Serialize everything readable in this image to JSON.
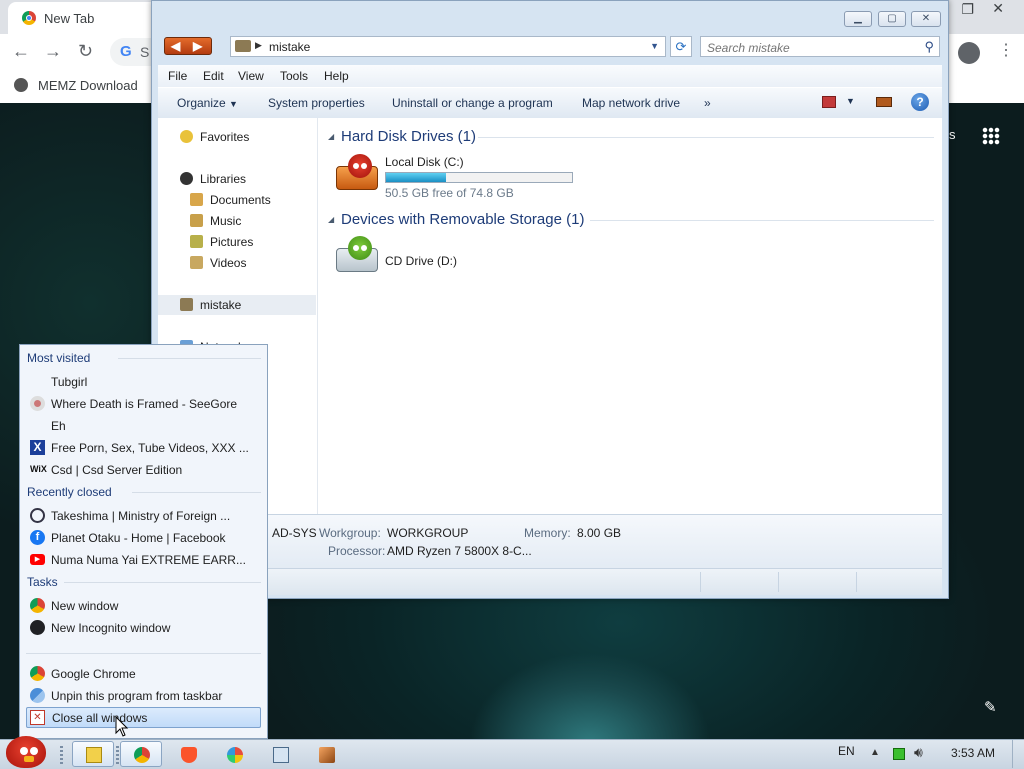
{
  "chrome": {
    "tab_title": "New Tab",
    "omnibox_partial": "S",
    "bookmark": "MEMZ Download",
    "right_partial": "s"
  },
  "explorer": {
    "address": "mistake",
    "search_placeholder": "Search mistake",
    "menu": [
      "File",
      "Edit",
      "View",
      "Tools",
      "Help"
    ],
    "commands": {
      "organize": "Organize",
      "system_properties": "System properties",
      "uninstall": "Uninstall or change a program",
      "map_drive": "Map network drive",
      "more": "»"
    },
    "nav": {
      "favorites": "Favorites",
      "libraries": "Libraries",
      "documents": "Documents",
      "music": "Music",
      "pictures": "Pictures",
      "videos": "Videos",
      "computer": "mistake",
      "network_partial": "Network",
      "homegroup_partial": "g"
    },
    "groups": {
      "hdd": "Hard Disk Drives (1)",
      "removable": "Devices with Removable Storage (1)"
    },
    "drives": {
      "c_name": "Local Disk (C:)",
      "c_free": "50.5 GB free of 74.8 GB",
      "c_used_fraction": 0.325,
      "d_name": "CD Drive (D:)"
    },
    "details": {
      "computer_partial": "AD-SYS",
      "workgroup_label": "Workgroup:",
      "workgroup_value": "WORKGROUP",
      "memory_label": "Memory:",
      "memory_value": "8.00 GB",
      "processor_label": "Processor:",
      "processor_value": "AMD Ryzen 7 5800X 8-C..."
    }
  },
  "jumplist": {
    "most_visited_header": "Most visited",
    "most_visited": [
      "Tubgirl",
      "Where Death is Framed - SeeGore",
      "Eh",
      "Free Porn, Sex, Tube Videos, XXX ...",
      "Csd | Csd Server Edition"
    ],
    "recently_closed_header": "Recently closed",
    "recently_closed": [
      "Takeshima | Ministry of Foreign ...",
      "Planet Otaku - Home | Facebook",
      "Numa Numa Yai EXTREME EARR..."
    ],
    "tasks_header": "Tasks",
    "tasks": [
      "New window",
      "New Incognito window"
    ],
    "app_name": "Google Chrome",
    "unpin": "Unpin this program from taskbar",
    "close_all": "Close all windows"
  },
  "taskbar": {
    "language": "EN",
    "time": "3:53 AM"
  }
}
